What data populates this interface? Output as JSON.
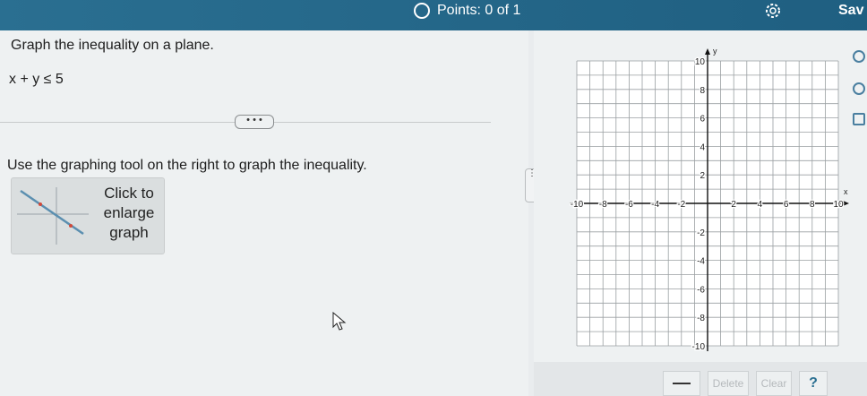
{
  "header": {
    "points_label": "Points: 0 of 1",
    "save_label": "Sav"
  },
  "question": {
    "prompt": "Graph the inequality on a plane.",
    "inequality": "x + y ≤ 5",
    "more_button": "• • •",
    "instruction": "Use the graphing tool on the right to graph the inequality."
  },
  "enlarge": {
    "line1": "Click to",
    "line2": "enlarge",
    "line3": "graph"
  },
  "graph": {
    "x_axis_label": "x",
    "y_axis_label": "y",
    "x_ticks": [
      {
        "label": "-10",
        "value": -10
      },
      {
        "label": "-8",
        "value": -8
      },
      {
        "label": "-6",
        "value": -6
      },
      {
        "label": "-4",
        "value": -4
      },
      {
        "label": "-2",
        "value": -2
      },
      {
        "label": "2",
        "value": 2
      },
      {
        "label": "4",
        "value": 4
      },
      {
        "label": "6",
        "value": 6
      },
      {
        "label": "8",
        "value": 8
      },
      {
        "label": "10",
        "value": 10
      }
    ],
    "y_ticks": [
      {
        "label": "10",
        "value": 10
      },
      {
        "label": "8",
        "value": 8
      },
      {
        "label": "6",
        "value": 6
      },
      {
        "label": "4",
        "value": 4
      },
      {
        "label": "2",
        "value": 2
      },
      {
        "label": "-2",
        "value": -2
      },
      {
        "label": "-4",
        "value": -4
      },
      {
        "label": "-6",
        "value": -6
      },
      {
        "label": "-8",
        "value": -8
      },
      {
        "label": "-10",
        "value": -10
      }
    ],
    "x_range": [
      -10,
      10
    ],
    "y_range": [
      -10,
      10
    ],
    "grid": true
  },
  "toolbar": {
    "delete_label": "Delete",
    "clear_label": "Clear",
    "help_label": "?"
  },
  "colors": {
    "header_bg": "#246a8c",
    "accent": "#2a6f91"
  }
}
